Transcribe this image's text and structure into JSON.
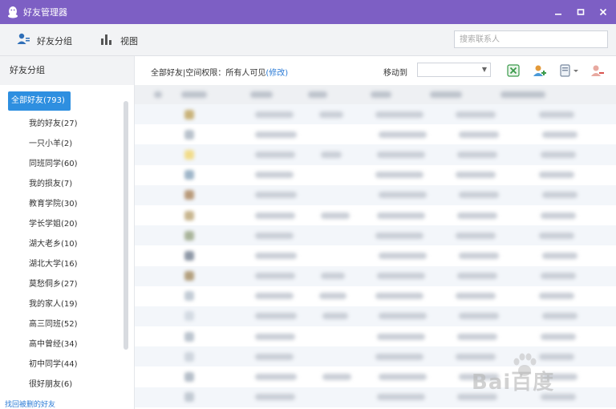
{
  "window": {
    "title": "好友管理器",
    "colors": {
      "titlebar": "#7d5fc4",
      "accent": "#2e8fe0"
    }
  },
  "toolbar": {
    "friend_groups_label": "好友分组",
    "view_label": "视图",
    "search_placeholder": "搜索联系人"
  },
  "sidebar": {
    "header": "好友分组",
    "groups": [
      {
        "label": "全部好友(793)",
        "selected": true
      },
      {
        "label": "我的好友(27)"
      },
      {
        "label": "一只小羊(2)"
      },
      {
        "label": "同班同学(60)"
      },
      {
        "label": "我的损友(7)"
      },
      {
        "label": "教育学院(30)"
      },
      {
        "label": "学长学姐(20)"
      },
      {
        "label": "湖大老乡(10)"
      },
      {
        "label": "湖北大学(16)"
      },
      {
        "label": "莫愁侗乡(27)"
      },
      {
        "label": "我的家人(19)"
      },
      {
        "label": "高三同班(52)"
      },
      {
        "label": "高中曾经(34)"
      },
      {
        "label": "初中同学(44)"
      },
      {
        "label": "很好朋友(6)"
      }
    ],
    "bottom_link": "找回被删的好友"
  },
  "main": {
    "breadcrumb_prefix": "全部好友|空间权限：所有人可见",
    "breadcrumb_modify": "(修改)",
    "move_to_label": "移动到",
    "move_to_value": ""
  },
  "watermark": {
    "text": "Bai百度"
  }
}
